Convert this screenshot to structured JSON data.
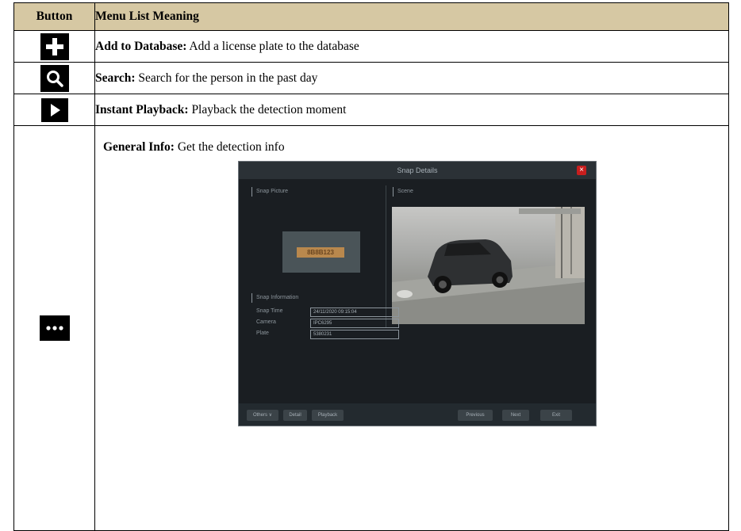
{
  "header": {
    "button": "Button",
    "meaning": "Menu List Meaning"
  },
  "rows": [
    {
      "icon": "plus-icon",
      "term": "Add to Database:",
      "desc": " Add a license plate to the database"
    },
    {
      "icon": "search-icon",
      "term": "Search:",
      "desc": " Search for the person in the past day"
    },
    {
      "icon": "play-icon",
      "term": "Instant Playback:",
      "desc": " Playback the detection moment"
    },
    {
      "icon": "more-dots-icon",
      "term": "General Info:",
      "desc": " Get the detection info"
    }
  ],
  "screenshot": {
    "title": "Snap Details",
    "snap_picture_label": "Snap Picture",
    "scene_label": "Scene",
    "plate_text": "8B8B123",
    "snap_info_label": "Snap Information",
    "info": [
      {
        "label": "Snap Time",
        "value": "24/11/2020 09:15:04"
      },
      {
        "label": "Camera",
        "value": "IPC6295"
      },
      {
        "label": "Plate",
        "value": "5380231"
      }
    ],
    "footer_left": [
      "Others ∨",
      "Detail",
      "Playback"
    ],
    "footer_right": [
      "Previous",
      "Next",
      "Exit"
    ],
    "colors": {
      "titlebar": "#2b3136",
      "close": "#c81e1e",
      "header_bg": "#d6c8a3"
    }
  }
}
